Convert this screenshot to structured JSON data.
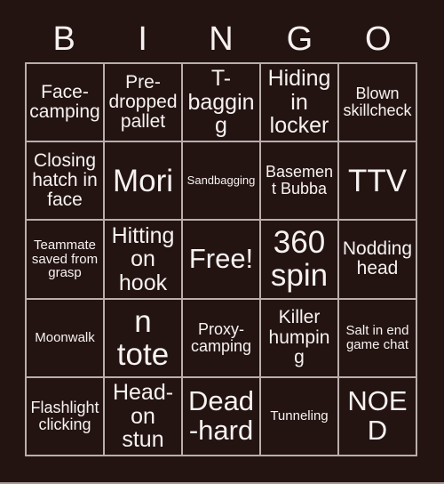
{
  "card": {
    "title": "BINGO",
    "background_color": "#231412",
    "text_color": "#f7f2f0",
    "line_color": "#b9aeab"
  },
  "header": {
    "letters": [
      "B",
      "I",
      "N",
      "G",
      "O"
    ]
  },
  "grid": {
    "rows": 5,
    "columns": 5,
    "cells": [
      [
        {
          "text": "Face-camping",
          "size": "md"
        },
        {
          "text": "Pre-dropped pallet",
          "size": "md"
        },
        {
          "text": "T-bagging",
          "size": "lg"
        },
        {
          "text": "Hiding in locker",
          "size": "lg"
        },
        {
          "text": "Blown skillcheck",
          "size": "sm"
        }
      ],
      [
        {
          "text": "Closing hatch in face",
          "size": "md"
        },
        {
          "text": "Mori",
          "size": "xxl"
        },
        {
          "text": "Sandbagging",
          "size": "xxs"
        },
        {
          "text": "Basement Bubba",
          "size": "sm"
        },
        {
          "text": "TTV",
          "size": "xxl"
        }
      ],
      [
        {
          "text": "Teammate saved from grasp",
          "size": "xs"
        },
        {
          "text": "Hitting on hook",
          "size": "lg"
        },
        {
          "text": "Free!",
          "size": "xl"
        },
        {
          "text": "360 spin",
          "size": "xxl"
        },
        {
          "text": "Nodding head",
          "size": "md"
        }
      ],
      [
        {
          "text": "Moonwalk",
          "size": "xs"
        },
        {
          "text": "Boon totem",
          "size": "xxl"
        },
        {
          "text": "Proxy-camping",
          "size": "sm"
        },
        {
          "text": "Killer humping",
          "size": "md"
        },
        {
          "text": "Salt in end game chat",
          "size": "xs"
        }
      ],
      [
        {
          "text": "Flashlight clicking",
          "size": "sm"
        },
        {
          "text": "Head-on stun",
          "size": "lg"
        },
        {
          "text": "Dead-hard",
          "size": "xl"
        },
        {
          "text": "Tunneling",
          "size": "xs"
        },
        {
          "text": "NOED",
          "size": "xl"
        }
      ]
    ]
  }
}
